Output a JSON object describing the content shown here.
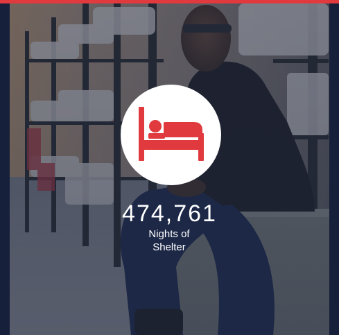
{
  "stat": {
    "value": "474,761",
    "label": "Nights of Shelter"
  },
  "icon": "bed-icon",
  "colors": {
    "accent": "#e03a3e",
    "overlay": "#1c263c",
    "text": "#ffffff"
  }
}
